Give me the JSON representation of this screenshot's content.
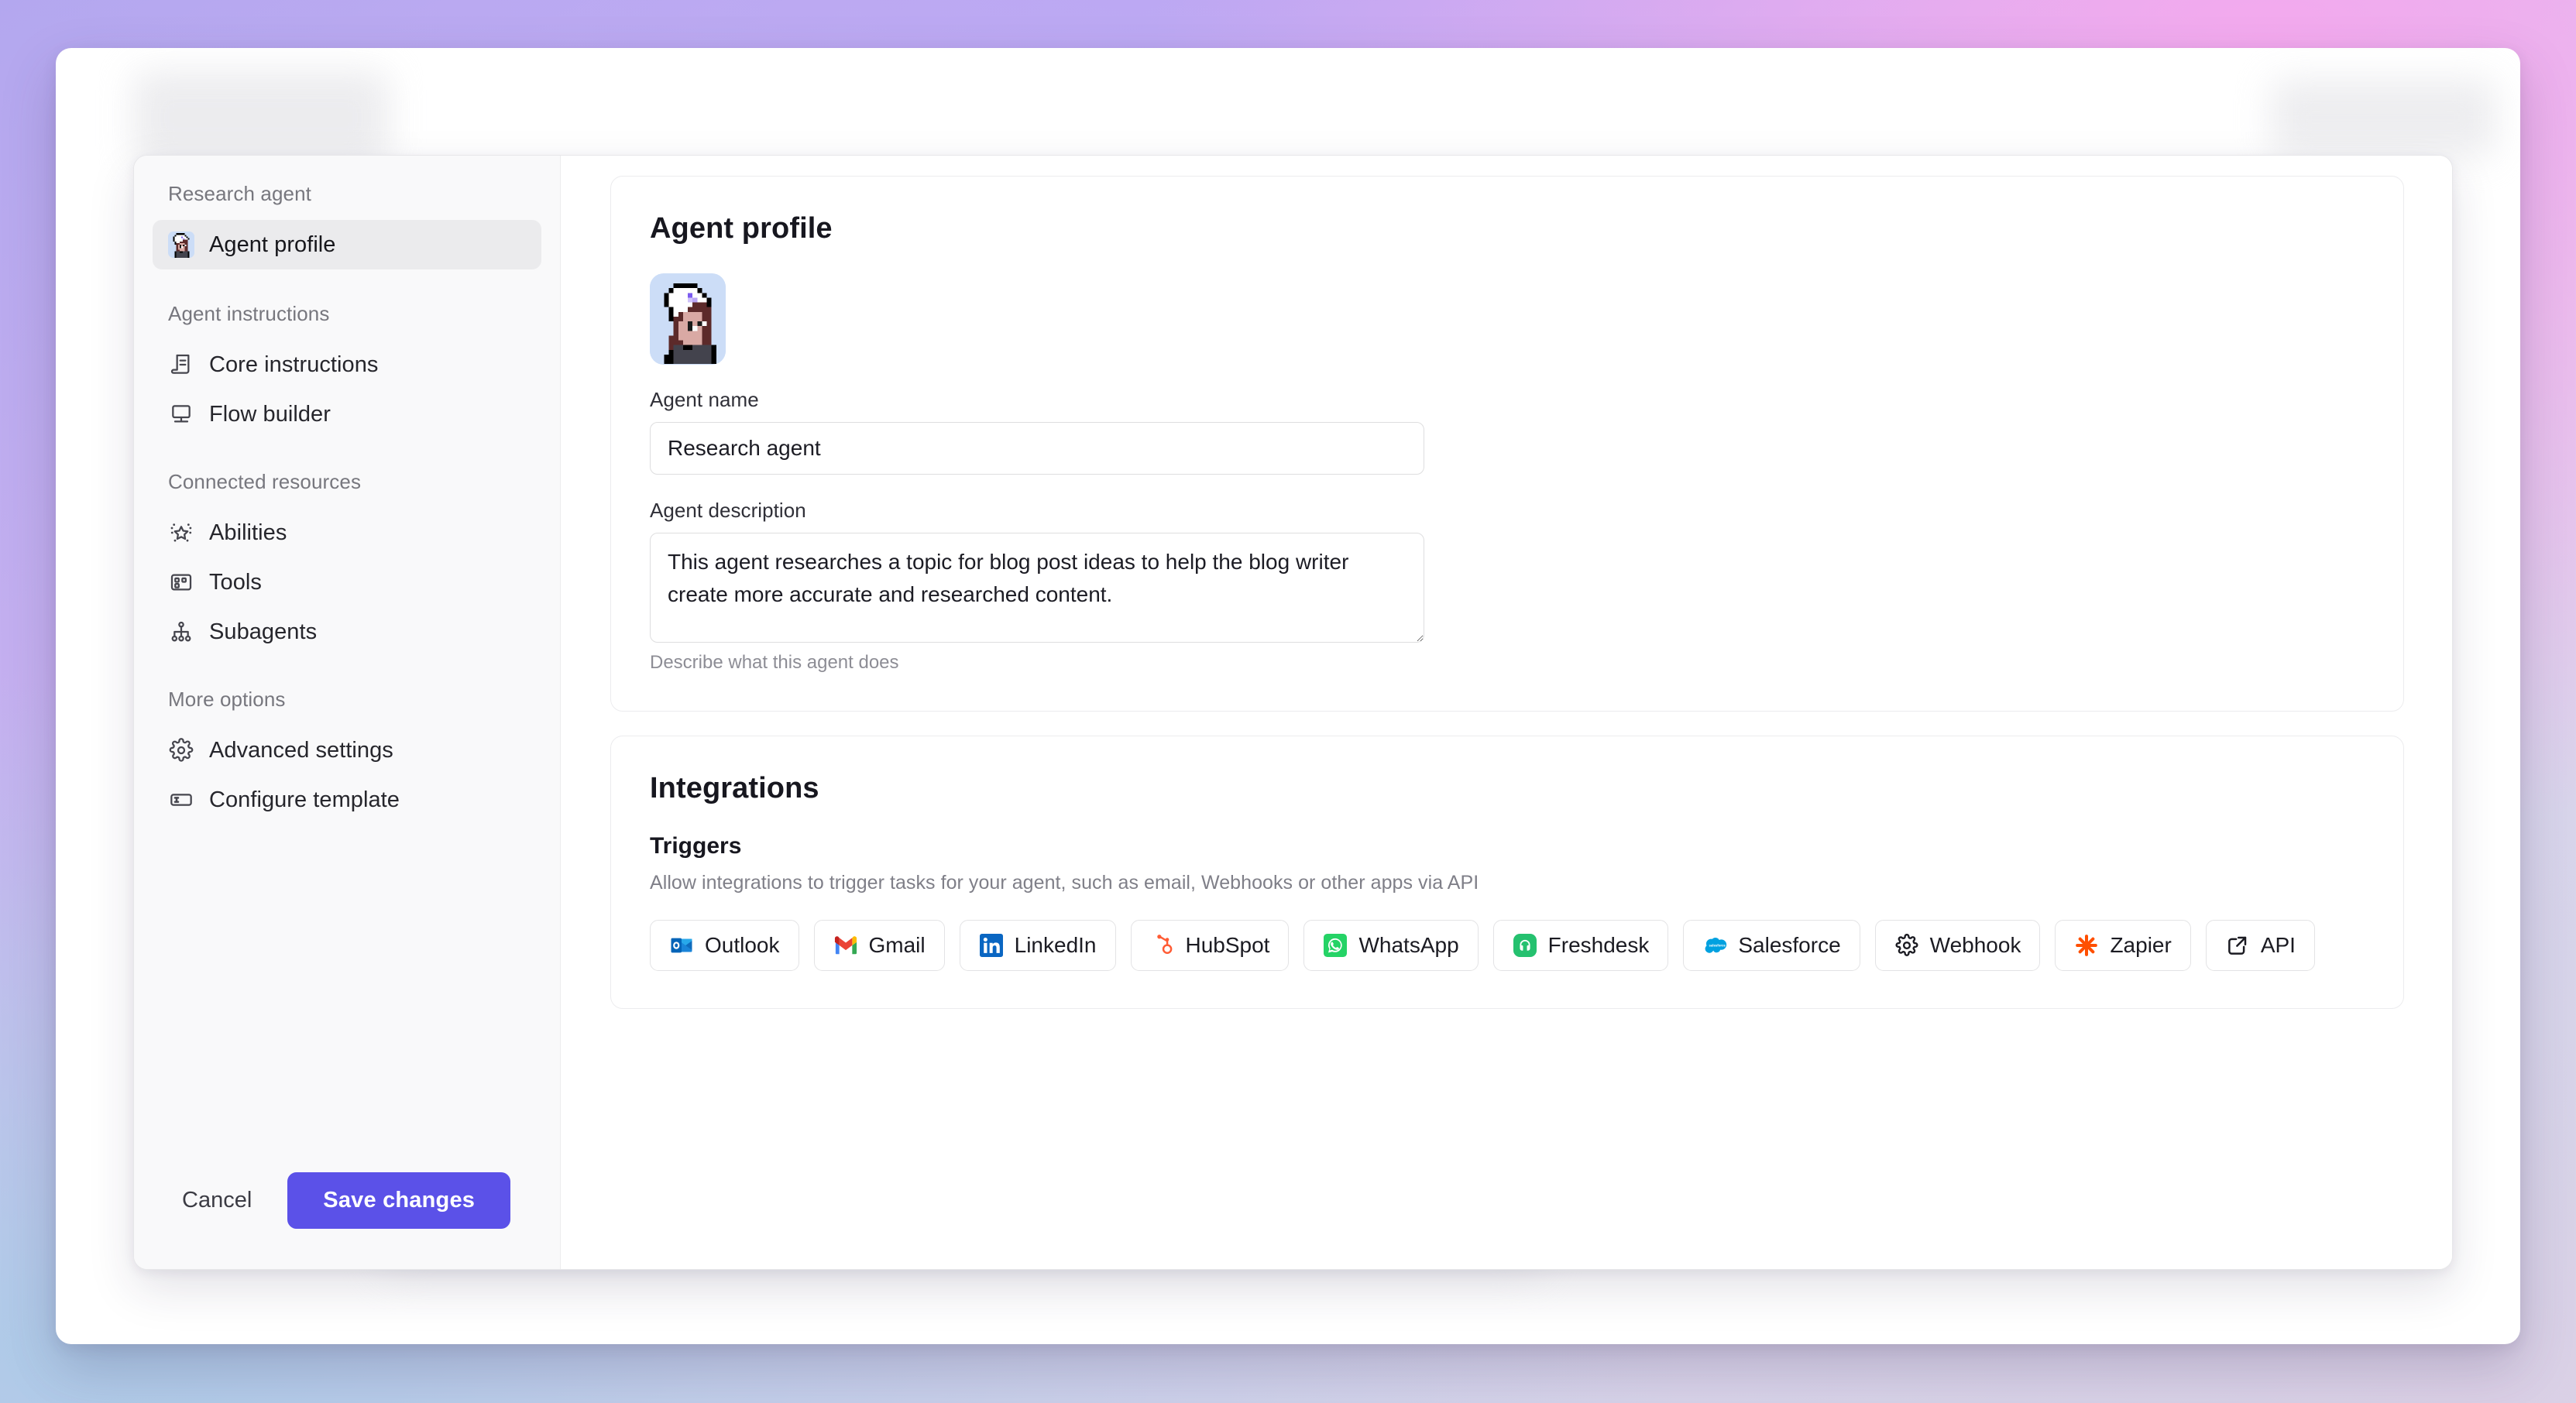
{
  "window": {
    "background_gradient": [
      "#b3a7ef",
      "#c9b2f0",
      "#e0d2ec",
      "#cfd8ea",
      "#f4a9ee"
    ]
  },
  "sidebar": {
    "groups": [
      {
        "heading": "Research agent",
        "items": [
          {
            "label": "Agent profile",
            "icon": "agent-avatar-icon",
            "active": true
          }
        ]
      },
      {
        "heading": "Agent instructions",
        "items": [
          {
            "label": "Core instructions",
            "icon": "document-instructions-icon",
            "active": false
          },
          {
            "label": "Flow builder",
            "icon": "flow-monitor-icon",
            "active": false
          }
        ]
      },
      {
        "heading": "Connected resources",
        "items": [
          {
            "label": "Abilities",
            "icon": "sparkle-star-icon",
            "active": false
          },
          {
            "label": "Tools",
            "icon": "tools-grid-icon",
            "active": false
          },
          {
            "label": "Subagents",
            "icon": "hierarchy-tree-icon",
            "active": false
          }
        ]
      },
      {
        "heading": "More options",
        "items": [
          {
            "label": "Advanced settings",
            "icon": "gear-icon",
            "active": false
          },
          {
            "label": "Configure template",
            "icon": "template-field-icon",
            "active": false
          }
        ]
      }
    ],
    "footer": {
      "cancel_label": "Cancel",
      "save_label": "Save changes",
      "save_color": "#5b51e8"
    }
  },
  "main": {
    "profile_card": {
      "title": "Agent profile",
      "avatar_alt": "pixel-art agent avatar",
      "name_label": "Agent name",
      "name_value": "Research agent",
      "description_label": "Agent description",
      "description_value": "This agent researches a topic for blog post ideas to help the blog writer create more accurate and researched content.",
      "description_help": "Describe what this agent does"
    },
    "integrations_card": {
      "title": "Integrations",
      "triggers_title": "Triggers",
      "triggers_desc": "Allow integrations to trigger tasks for your agent, such as email, Webhooks or other apps via API",
      "triggers": [
        {
          "label": "Outlook",
          "icon": "outlook-icon",
          "color": "#0f6cbd"
        },
        {
          "label": "Gmail",
          "icon": "gmail-icon",
          "color": "#ea4335"
        },
        {
          "label": "LinkedIn",
          "icon": "linkedin-icon",
          "color": "#0a66c2"
        },
        {
          "label": "HubSpot",
          "icon": "hubspot-icon",
          "color": "#ff5c35"
        },
        {
          "label": "WhatsApp",
          "icon": "whatsapp-icon",
          "color": "#25d366"
        },
        {
          "label": "Freshdesk",
          "icon": "freshdesk-icon",
          "color": "#25c16f"
        },
        {
          "label": "Salesforce",
          "icon": "salesforce-icon",
          "color": "#00a1e0"
        },
        {
          "label": "Webhook",
          "icon": "gear-webhook-icon",
          "color": "#1b1b22"
        },
        {
          "label": "Zapier",
          "icon": "zapier-icon",
          "color": "#ff4f00"
        },
        {
          "label": "API",
          "icon": "external-link-icon",
          "color": "#1b1b22"
        }
      ]
    }
  }
}
